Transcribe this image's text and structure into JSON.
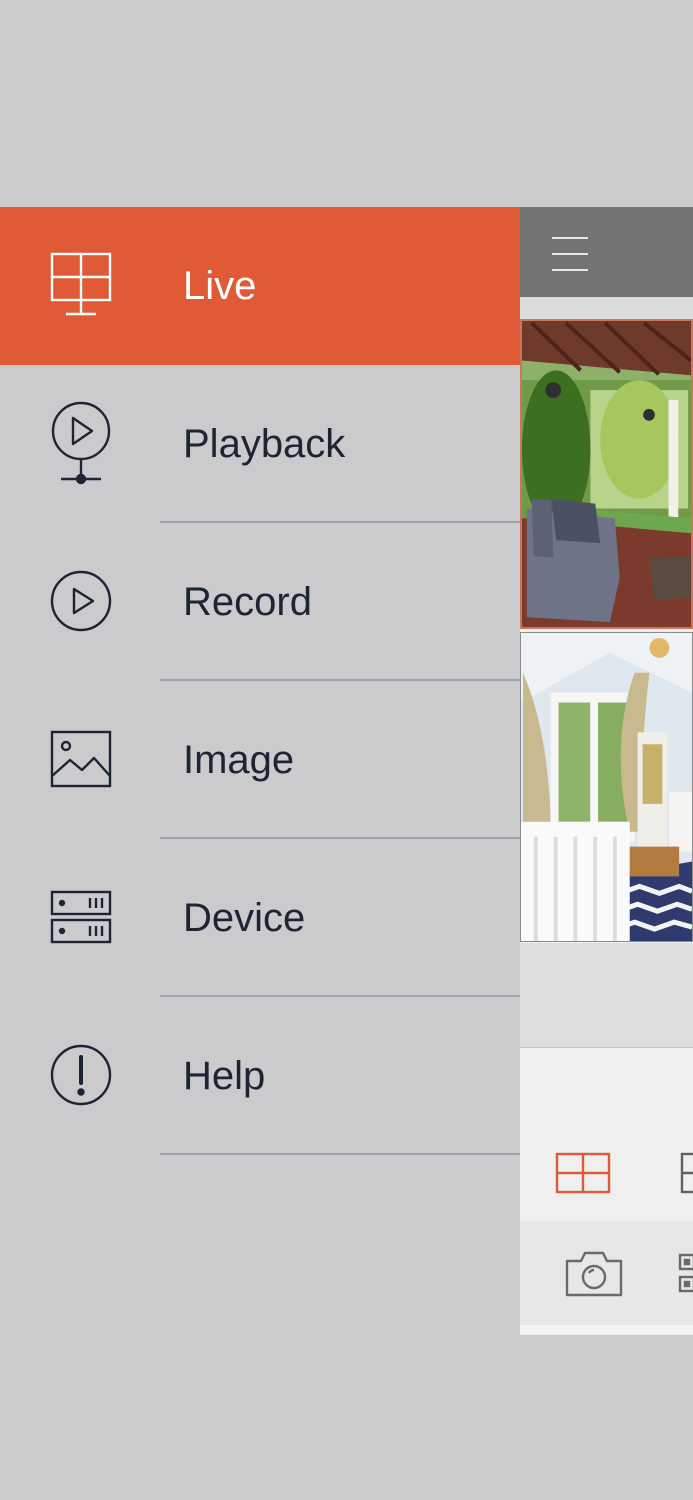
{
  "menu": {
    "items": [
      {
        "label": "Live",
        "icon": "monitor-grid-icon",
        "active": true
      },
      {
        "label": "Playback",
        "icon": "playback-network-icon"
      },
      {
        "label": "Record",
        "icon": "record-play-icon"
      },
      {
        "label": "Image",
        "icon": "image-icon"
      },
      {
        "label": "Device",
        "icon": "device-server-icon"
      },
      {
        "label": "Help",
        "icon": "help-exclamation-icon"
      }
    ]
  },
  "colors": {
    "accent": "#e05a35",
    "background": "#cbcbce",
    "menu_text": "#1d2433",
    "topbar": "#737374"
  },
  "live_panel": {
    "topbar_icon": "hamburger-menu-icon",
    "cameras": [
      "patio-camera-feed",
      "nursery-camera-feed"
    ],
    "layout_buttons": [
      "four-grid-layout-icon",
      "single-view-layout-icon"
    ],
    "toolbar_icons": [
      "camera-snapshot-icon",
      "qr-device-icon"
    ]
  }
}
